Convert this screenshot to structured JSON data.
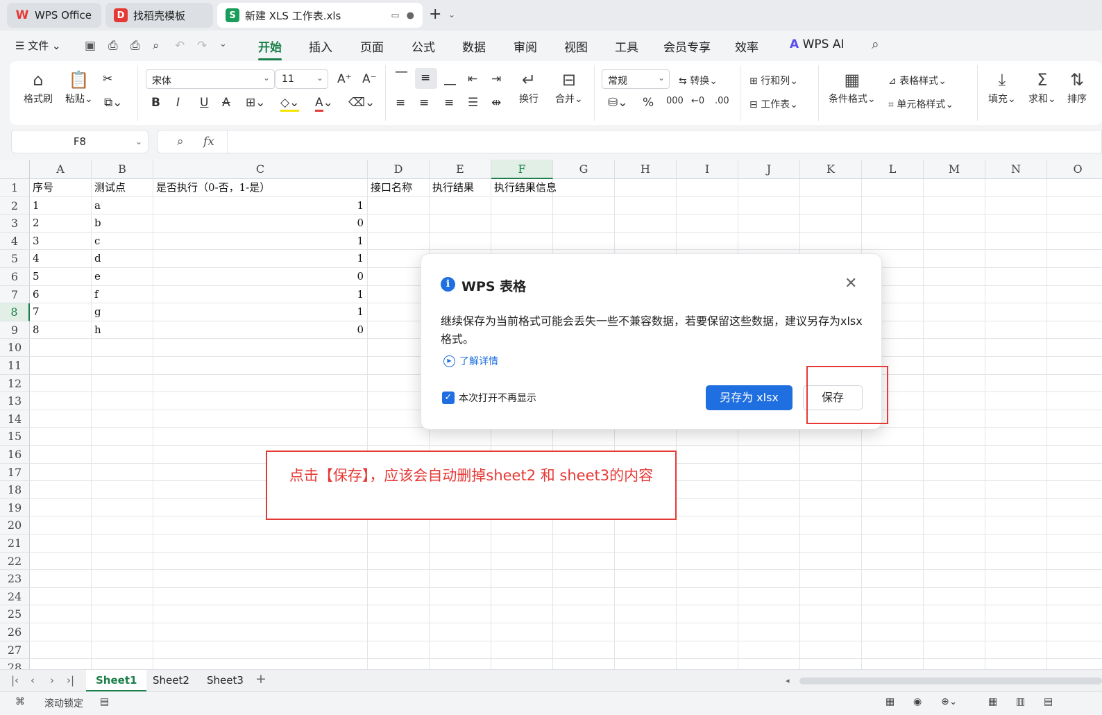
{
  "tabs": [
    {
      "label": "WPS Office",
      "logo": "W",
      "color": "#e53935"
    },
    {
      "label": "找稻壳模板",
      "logo": "D",
      "color": "#e53935"
    },
    {
      "label": "新建 XLS 工作表.xls",
      "logo": "S",
      "color": "#1a9c5b"
    }
  ],
  "menu": {
    "file": "文件",
    "items": [
      "开始",
      "插入",
      "页面",
      "公式",
      "数据",
      "审阅",
      "视图",
      "工具",
      "会员专享",
      "效率"
    ],
    "ai": "WPS AI"
  },
  "ribbon": {
    "format_painter": "格式刷",
    "paste": "粘贴",
    "font_name": "宋体",
    "font_size": "11",
    "wrap": "换行",
    "merge": "合并",
    "number_format": "常规",
    "convert": "转换",
    "row_col": "行和列",
    "worksheet": "工作表",
    "cond_format": "条件格式",
    "table_style": "表格样式",
    "cell_style": "单元格样式",
    "fill": "填充",
    "sum": "求和",
    "sort": "排序"
  },
  "namebox": "F8",
  "grid": {
    "columns": [
      "A",
      "B",
      "C",
      "D",
      "E",
      "F",
      "G",
      "H",
      "I",
      "J",
      "K",
      "L",
      "M",
      "N",
      "O"
    ],
    "selected_col": "F",
    "selected_row": 8,
    "rows_visible": 28,
    "header_row": [
      "序号",
      "测试点",
      "是否执行（0-否，1-是）",
      "接口名称",
      "执行结果",
      "执行结果信息"
    ],
    "data": [
      [
        "1",
        "a",
        "1"
      ],
      [
        "2",
        "b",
        "0"
      ],
      [
        "3",
        "c",
        "1"
      ],
      [
        "4",
        "d",
        "1"
      ],
      [
        "5",
        "e",
        "0"
      ],
      [
        "6",
        "f",
        "1"
      ],
      [
        "7",
        "g",
        "1"
      ],
      [
        "8",
        "h",
        "0"
      ]
    ]
  },
  "annotation": "点击【保存】，应该会自动删掉sheet2 和 sheet3的内容",
  "dialog": {
    "title": "WPS 表格",
    "message": "继续保存为当前格式可能会丢失一些不兼容数据，若要保留这些数据，建议另存为xlsx格式。",
    "link": "了解详情",
    "checkbox": "本次打开不再显示",
    "checkbox_checked": true,
    "btn_saveas": "另存为 xlsx",
    "btn_save": "保存"
  },
  "sheets": [
    "Sheet1",
    "Sheet2",
    "Sheet3"
  ],
  "active_sheet": "Sheet1",
  "status": {
    "scroll_lock": "滚动锁定"
  },
  "colors": {
    "accent": "#1a7f48",
    "primary": "#1f6fe0",
    "annotation": "#e53935"
  }
}
